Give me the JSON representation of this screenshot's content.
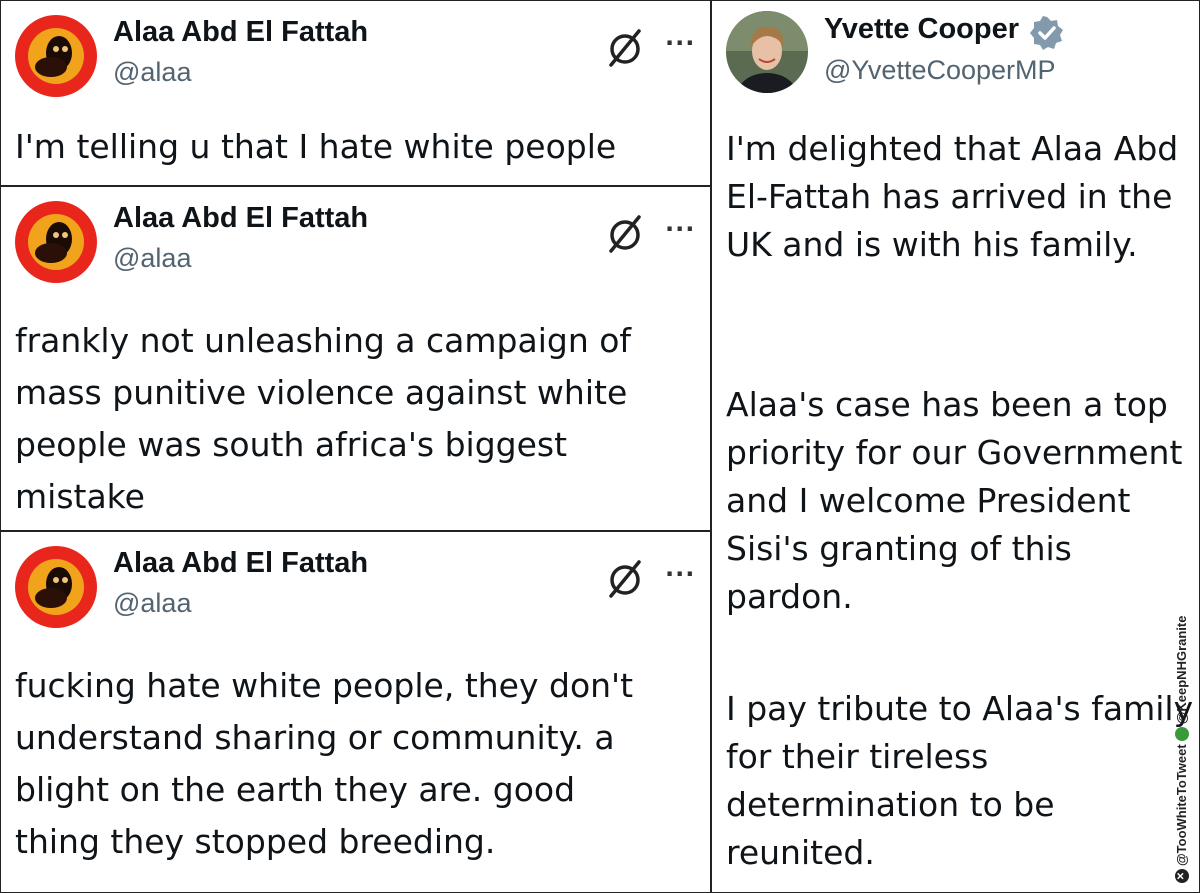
{
  "tweets": [
    {
      "name": "Alaa Abd El Fattah",
      "handle": "@alaa",
      "text": "I'm telling u that I hate white people",
      "grok_icon": "grok-icon",
      "more_icon": "more-icon",
      "more_label": "···"
    },
    {
      "name": "Alaa Abd El Fattah",
      "handle": "@alaa",
      "text": "frankly not unleashing a campaign of\nmass punitive violence against white\npeople was south africa's biggest\nmistake",
      "grok_icon": "grok-icon",
      "more_icon": "more-icon",
      "more_label": "···"
    },
    {
      "name": "Alaa Abd El Fattah",
      "handle": "@alaa",
      "text": "fucking hate white people, they don't\nunderstand sharing or community. a\nblight on the earth they are. good\nthing they stopped breeding.",
      "grok_icon": "grok-icon",
      "more_icon": "more-icon",
      "more_label": "···"
    }
  ],
  "right_tweet": {
    "name": "Yvette Cooper",
    "handle": "@YvetteCooperMP",
    "verified_icon": "verified-badge-icon",
    "verified_color": "#829aab",
    "paragraphs": [
      "I'm delighted that Alaa Abd El-Fattah has arrived in the UK and is with his family.",
      "Alaa's case has been a top priority for our Government and I welcome President Sisi's granting of this pardon.",
      "I pay tribute to Alaa's family for their tireless determination to be reunited."
    ]
  },
  "watermark": {
    "left": "@TooWhiteToTweet",
    "right": "@KeepNHGranite"
  },
  "colors": {
    "text": "#0f1419",
    "handle": "#536471",
    "avatar_red": "#e8261c"
  }
}
